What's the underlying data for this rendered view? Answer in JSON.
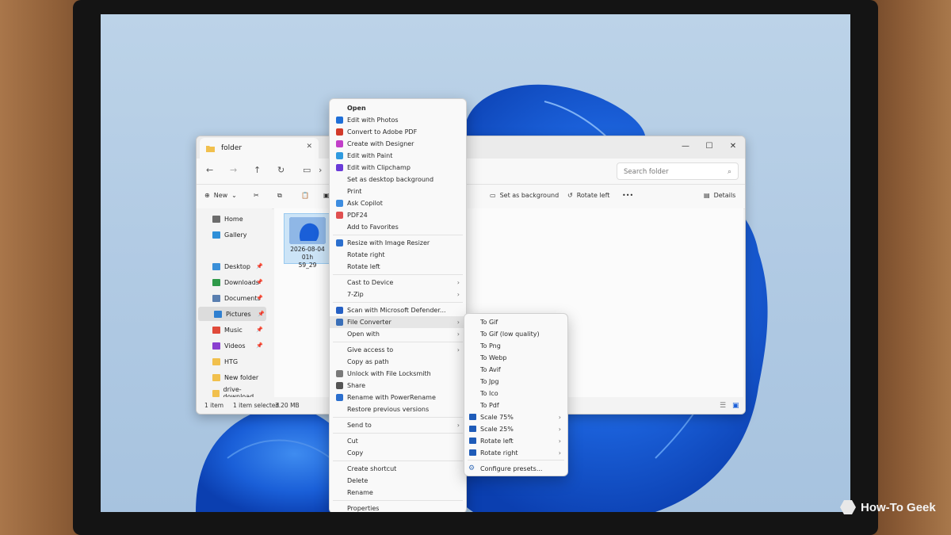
{
  "explorer": {
    "tab_title": "folder",
    "search_placeholder": "Search folder",
    "cmd": {
      "new": "New",
      "set_background": "Set as background",
      "rotate_left": "Rotate left",
      "more": "•••",
      "details": "Details"
    },
    "sidebar": [
      {
        "label": "Home",
        "pinned": false
      },
      {
        "label": "Gallery",
        "pinned": false
      },
      {
        "label": "Desktop",
        "pinned": true
      },
      {
        "label": "Downloads",
        "pinned": true
      },
      {
        "label": "Documents",
        "pinned": true
      },
      {
        "label": "Pictures",
        "pinned": true
      },
      {
        "label": "Music",
        "pinned": true
      },
      {
        "label": "Videos",
        "pinned": true
      },
      {
        "label": "HTG",
        "pinned": false
      },
      {
        "label": "New folder",
        "pinned": false
      },
      {
        "label": "drive-download",
        "pinned": false
      }
    ],
    "file": {
      "name_line1": "2026-08-04 01h",
      "name_line2": "59_29"
    },
    "status": {
      "count": "1 item",
      "selected": "1 item selected",
      "size": "3.20 MB"
    }
  },
  "context_menu": [
    {
      "label": "Open",
      "bold": true
    },
    {
      "label": "Edit with Photos",
      "icon": "photos-icon",
      "color": "#1f6fd8"
    },
    {
      "label": "Convert to Adobe PDF",
      "icon": "adobe-pdf-icon",
      "color": "#d23a2a"
    },
    {
      "label": "Create with Designer",
      "icon": "designer-icon",
      "color": "#c23fc9"
    },
    {
      "label": "Edit with Paint",
      "icon": "paint-icon",
      "color": "#2f9adf"
    },
    {
      "label": "Edit with Clipchamp",
      "icon": "clipchamp-icon",
      "color": "#6a3bd8"
    },
    {
      "label": "Set as desktop background"
    },
    {
      "label": "Print"
    },
    {
      "label": "Ask Copilot",
      "icon": "copilot-icon",
      "color": "#3e8de0"
    },
    {
      "label": "PDF24",
      "icon": "pdf24-icon",
      "color": "#e05050"
    },
    {
      "label": "Add to Favorites"
    },
    {
      "sep": true
    },
    {
      "label": "Resize with Image Resizer",
      "icon": "image-resizer-icon",
      "color": "#2b6fce"
    },
    {
      "label": "Rotate right"
    },
    {
      "label": "Rotate left"
    },
    {
      "sep": true
    },
    {
      "label": "Cast to Device",
      "submenu": true
    },
    {
      "label": "7-Zip",
      "submenu": true
    },
    {
      "sep": true
    },
    {
      "label": "Scan with Microsoft Defender...",
      "icon": "defender-icon",
      "color": "#2560c4"
    },
    {
      "label": "File Converter",
      "icon": "file-converter-icon",
      "color": "#3a6fb8",
      "submenu": true,
      "highlight": true
    },
    {
      "label": "Open with",
      "submenu": true
    },
    {
      "sep": true
    },
    {
      "label": "Give access to",
      "submenu": true
    },
    {
      "label": "Copy as path"
    },
    {
      "label": "Unlock with File Locksmith",
      "icon": "lock-icon",
      "color": "#7a7a7a"
    },
    {
      "label": "Share",
      "icon": "share-icon",
      "color": "#555555"
    },
    {
      "label": "Rename with PowerRename",
      "icon": "power-rename-icon",
      "color": "#2b6fce"
    },
    {
      "label": "Restore previous versions"
    },
    {
      "sep": true
    },
    {
      "label": "Send to",
      "submenu": true
    },
    {
      "sep": true
    },
    {
      "label": "Cut"
    },
    {
      "label": "Copy"
    },
    {
      "sep": true
    },
    {
      "label": "Create shortcut"
    },
    {
      "label": "Delete"
    },
    {
      "label": "Rename"
    },
    {
      "sep": true
    },
    {
      "label": "Properties"
    }
  ],
  "submenu": [
    {
      "label": "To Gif"
    },
    {
      "label": "To Gif (low quality)"
    },
    {
      "label": "To Png"
    },
    {
      "label": "To Webp"
    },
    {
      "label": "To Avif"
    },
    {
      "label": "To Jpg"
    },
    {
      "label": "To Ico"
    },
    {
      "label": "To Pdf"
    },
    {
      "label": "Scale 75%",
      "folder": true,
      "submenu": true
    },
    {
      "label": "Scale 25%",
      "folder": true,
      "submenu": true
    },
    {
      "label": "Rotate left",
      "folder": true,
      "submenu": true
    },
    {
      "label": "Rotate right",
      "folder": true,
      "submenu": true
    },
    {
      "sep": true
    },
    {
      "label": "Configure presets...",
      "gear": true
    }
  ],
  "brand": {
    "name": "How-To Geek"
  }
}
